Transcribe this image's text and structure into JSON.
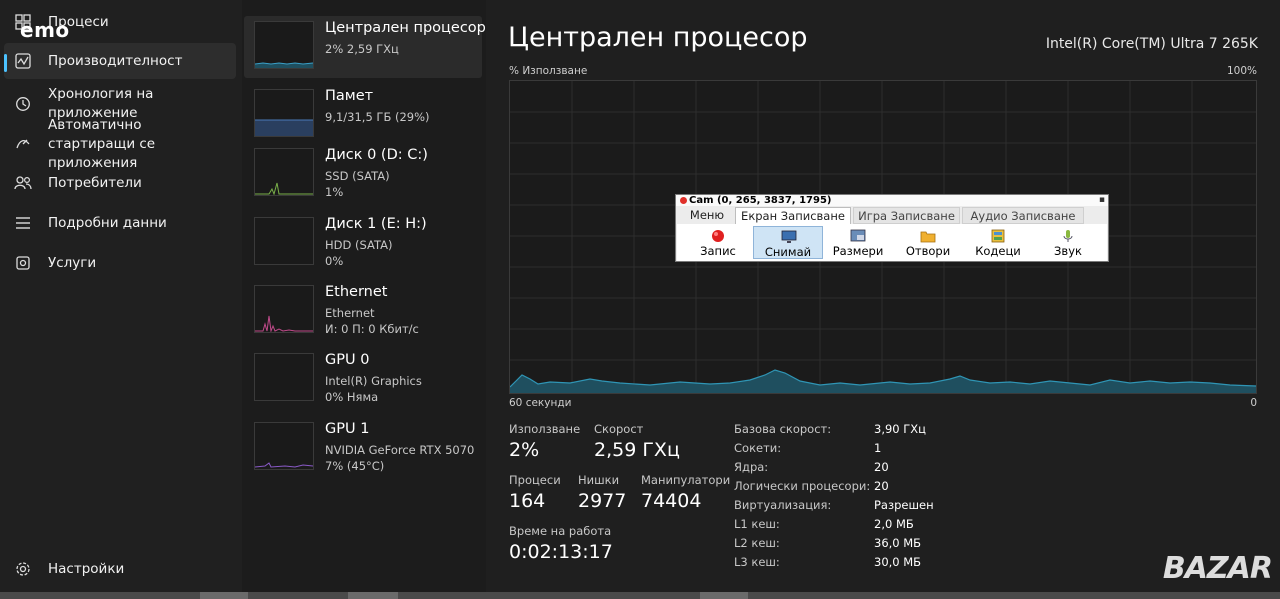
{
  "watermark_top": "emo",
  "watermark_bottom": "BAZAR",
  "sidebar": {
    "items": [
      {
        "label": "Процеси",
        "icon": "processes-icon"
      },
      {
        "label": "Производителност",
        "icon": "performance-icon"
      },
      {
        "label": "Хронология на приложение",
        "icon": "history-icon"
      },
      {
        "label": "Автоматично стартиращи се приложения",
        "icon": "startup-icon"
      },
      {
        "label": "Потребители",
        "icon": "users-icon"
      },
      {
        "label": "Подробни данни",
        "icon": "details-icon"
      },
      {
        "label": "Услуги",
        "icon": "services-icon"
      }
    ],
    "settings_label": "Настройки"
  },
  "devices": [
    {
      "name": "Централен процесор",
      "sub1": "2% 2,59 ГХц",
      "sub2": "",
      "line_color": "#3aa0c8"
    },
    {
      "name": "Памет",
      "sub1": "9,1/31,5 ГБ (29%)",
      "sub2": "",
      "line_color": "#4a7ab8"
    },
    {
      "name": "Диск 0 (D: C:)",
      "sub1": "SSD (SATA)",
      "sub2": "1%",
      "line_color": "#7ab04a"
    },
    {
      "name": "Диск 1 (E: H:)",
      "sub1": "HDD (SATA)",
      "sub2": "0%",
      "line_color": "#7ab04a"
    },
    {
      "name": "Ethernet",
      "sub1": "Ethernet",
      "sub2": "И: 0 П: 0 Кбит/с",
      "line_color": "#c04a8a"
    },
    {
      "name": "GPU 0",
      "sub1": "Intel(R) Graphics",
      "sub2": "0% Няма",
      "line_color": "#8a5ac8"
    },
    {
      "name": "GPU 1",
      "sub1": "NVIDIA GeForce RTX 5070",
      "sub2": "7% (45°C)",
      "line_color": "#8a5ac8"
    }
  ],
  "main": {
    "title": "Централен процесор",
    "cpu_model": "Intel(R) Core(TM) Ultra 7 265K",
    "graph_label": "% Използване",
    "graph_max": "100%",
    "graph_time": "60 секунди",
    "graph_zero": "0",
    "stats": {
      "usage_label": "Използване",
      "usage": "2%",
      "speed_label": "Скорост",
      "speed": "2,59 ГХц",
      "processes_label": "Процеси",
      "processes": "164",
      "threads_label": "Нишки",
      "threads": "2977",
      "handles_label": "Манипулатори",
      "handles": "74404",
      "uptime_label": "Време на работа",
      "uptime": "0:02:13:17"
    },
    "specs": [
      {
        "label": "Базова скорост:",
        "value": "3,90 ГХц"
      },
      {
        "label": "Сокети:",
        "value": "1"
      },
      {
        "label": "Ядра:",
        "value": "20"
      },
      {
        "label": "Логически процесори:",
        "value": "20"
      },
      {
        "label": "Виртуализация:",
        "value": "Разрешен"
      },
      {
        "label": "L1 кеш:",
        "value": "2,0 МБ"
      },
      {
        "label": "L2 кеш:",
        "value": "36,0 МБ"
      },
      {
        "label": "L3 кеш:",
        "value": "30,0 МБ"
      }
    ]
  },
  "camstudio": {
    "title": "Cam (0, 265, 3837, 1795)",
    "tabs": [
      "Меню",
      "Екран Записване",
      "Игра Записване",
      "Аудио Записване"
    ],
    "buttons": [
      "Запис",
      "Снимай",
      "Размери",
      "Отвори",
      "Кодеци",
      "Звук"
    ]
  },
  "colors": {
    "accent": "#4cc2ff",
    "graph_fill": "#1f4f5f",
    "graph_line": "#2f95b5"
  }
}
